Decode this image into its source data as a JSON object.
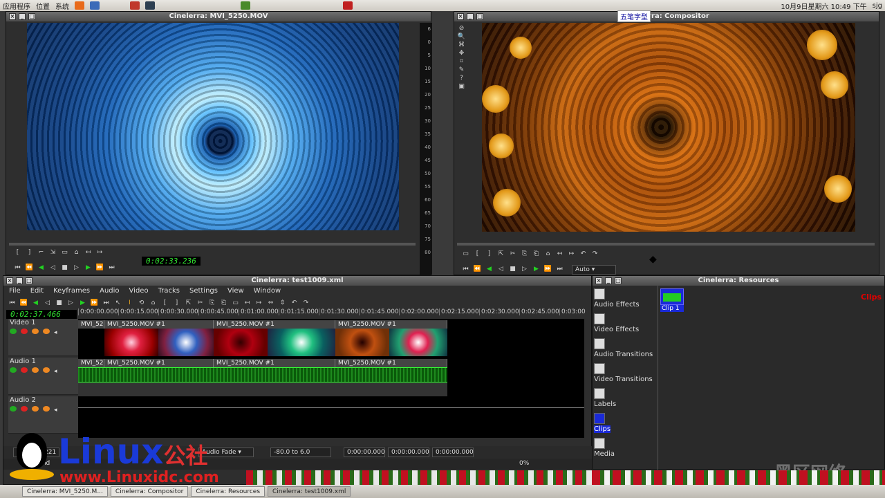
{
  "panel": {
    "apps": "应用程序",
    "places": "位置",
    "system": "系统",
    "clock": "10月9日星期六 10:49 下午",
    "user": "sjg",
    "ime": "五笔字型"
  },
  "viewer": {
    "title": "Cinelerra: MVI_5250.MOV",
    "timecode": "0:02:33.236",
    "meter_ticks": [
      "6",
      "0",
      "5",
      "10",
      "15",
      "20",
      "25",
      "30",
      "35",
      "40",
      "45",
      "50",
      "55",
      "60",
      "65",
      "70",
      "75",
      "80"
    ]
  },
  "compositor": {
    "title": "Cinelerra: Compositor",
    "zoom": "Auto"
  },
  "program": {
    "title": "Cinelerra: test1009.xml",
    "menu": [
      "File",
      "Edit",
      "Keyframes",
      "Audio",
      "Video",
      "Tracks",
      "Settings",
      "View",
      "Window"
    ],
    "timecode": "0:02:37.466",
    "ruler": [
      "0:00:00.000",
      "0:00:15.000",
      "0:00:30.000",
      "0:00:45.000",
      "0:01:00.000",
      "0:01:15.000",
      "0:01:30.000",
      "0:01:45.000",
      "0:02:00.000",
      "0:02:15.000",
      "0:02:30.000",
      "0:02:45.000",
      "0:03:00"
    ],
    "tracks": [
      {
        "name": "Video 1"
      },
      {
        "name": "Audio 1"
      },
      {
        "name": "Audio 2"
      }
    ],
    "clip_short": "MVI_52",
    "clip_name": "MVI_5250.MOV #1",
    "fade_label": "Audio Fade",
    "fade_range": "-80.0 to 6.0",
    "time_fields": [
      "0:00:00.000",
      "0:00:00.000",
      "0:00:00.000"
    ],
    "percent": "0%",
    "status_left": "0",
    "status_num": "221",
    "status_path": "ine/rend"
  },
  "resources": {
    "title": "Cinelerra: Resources",
    "folders": [
      "Audio Effects",
      "Video Effects",
      "Audio Transitions",
      "Video Transitions",
      "Labels",
      "Clips",
      "Media"
    ],
    "selected": "Clips",
    "heading": "Clips",
    "clip_item": "Clip 1"
  },
  "taskbar": {
    "items": [
      "Cinelerra: MVI_5250.M...",
      "Cinelerra: Compositor",
      "Cinelerra: Resources",
      "Cinelerra: test1009.xml"
    ]
  },
  "watermark": {
    "logo": "Linux",
    "logo_cn": "公社",
    "url": "www.Linuxidc.com",
    "right": "黑区网络"
  },
  "colors": {
    "accent_green": "#22d322",
    "clips_red": "#e00000",
    "selection_blue": "#1a2ad8"
  }
}
